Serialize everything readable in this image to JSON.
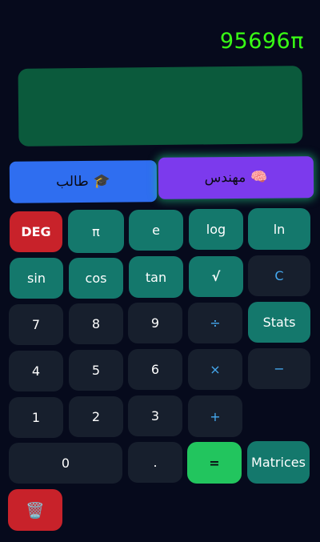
{
  "expression": "95696π",
  "modes": {
    "student": {
      "label": "طالب",
      "icon": "🎓"
    },
    "engineer": {
      "label": "مهندس",
      "icon": "🧠"
    }
  },
  "keys": {
    "deg": "DEG",
    "pi": "π",
    "e": "e",
    "log": "log",
    "ln": "ln",
    "sin": "sin",
    "cos": "cos",
    "tan": "tan",
    "sqrt": "√",
    "clear": "C",
    "seven": "7",
    "eight": "8",
    "nine": "9",
    "divide": "÷",
    "stats": "Stats",
    "four": "4",
    "five": "5",
    "six": "6",
    "multiply": "×",
    "minus": "−",
    "one": "1",
    "two": "2",
    "three": "3",
    "plus": "+",
    "zero": "0",
    "dot": ".",
    "equals": "=",
    "matrices": "Matrices",
    "trash": "🗑️"
  },
  "colors": {
    "background": "#060a1c",
    "teal": "#14786c",
    "dark": "#171f2d",
    "red": "#c8222a",
    "green": "#22c55e",
    "expression": "#39ff14",
    "operator": "#45a8ee",
    "student": "#2f6ef0",
    "engineer": "#7c3aed"
  }
}
